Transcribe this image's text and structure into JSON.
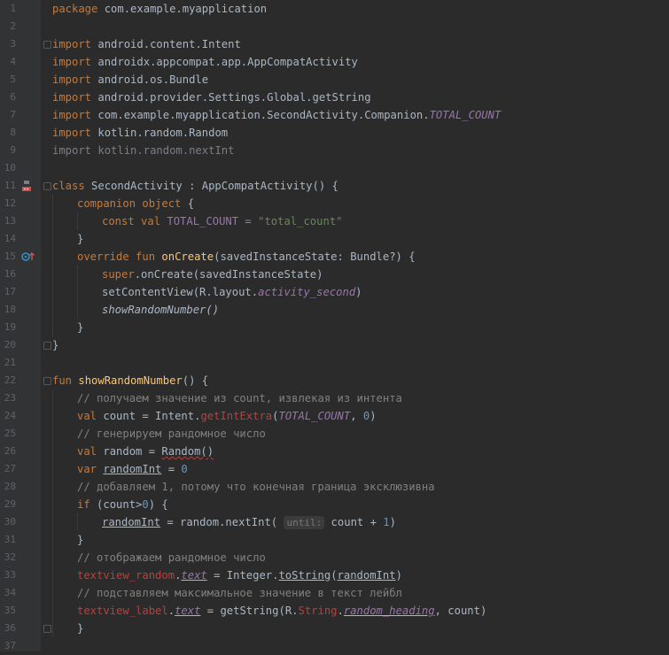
{
  "editor": {
    "line_numbers": [
      "1",
      "2",
      "3",
      "4",
      "5",
      "6",
      "7",
      "8",
      "9",
      "10",
      "11",
      "12",
      "13",
      "14",
      "15",
      "16",
      "17",
      "18",
      "19",
      "20",
      "21",
      "22",
      "23",
      "24",
      "25",
      "26",
      "27",
      "28",
      "29",
      "30",
      "31",
      "32",
      "33",
      "34",
      "35",
      "36",
      "37"
    ],
    "gutter_icons": {
      "line11": "class-hierarchy-icon",
      "line15": "override-method-icon"
    },
    "code": {
      "l1_kw": "package",
      "l1_rest": " com.example.myapplication",
      "l3_kw": "import",
      "l3_rest": " android.content.Intent",
      "l4_kw": "import",
      "l4_rest": " androidx.appcompat.app.AppCompatActivity",
      "l5_kw": "import",
      "l5_rest": " android.os.Bundle",
      "l6_kw": "import",
      "l6_rest": " android.provider.Settings.Global.getString",
      "l7_kw": "import",
      "l7_rest": " com.example.myapplication.SecondActivity.Companion.",
      "l7_prop": "TOTAL_COUNT",
      "l8_kw": "import",
      "l8_rest": " kotlin.random.Random",
      "l9_kw": "import",
      "l9_rest": " kotlin.random.nextInt",
      "l11_kw": "class",
      "l11_rest": " SecondActivity : AppCompatActivity() {",
      "l12_kw": "companion object",
      "l12_rest": " {",
      "l13_kw": "const val",
      "l13_mid": " TOTAL_COUNT = ",
      "l13_str": "\"total_count\"",
      "l14": "}",
      "l15_kw": "override fun",
      "l15_fn": "onCreate",
      "l15_rest": "(savedInstanceState: Bundle?) {",
      "l16_kw": "super",
      "l16_rest": ".onCreate(savedInstanceState)",
      "l17_a": "setContentView(R.layout.",
      "l17_prop": "activity_second",
      "l17_b": ")",
      "l18": "showRandomNumber()",
      "l19": "}",
      "l20": "}",
      "l22_kw": "fun",
      "l22_fn": "showRandomNumber",
      "l22_rest": "() {",
      "l23": "// получаем значение из count, извлекая из интента",
      "l24_kw": "val",
      "l24_a": " count = Intent.",
      "l24_err": "getIntExtra",
      "l24_b": "(",
      "l24_prop": "TOTAL_COUNT",
      "l24_c": ", ",
      "l24_num": "0",
      "l24_d": ")",
      "l25": "// генерируем рандомное число",
      "l26_kw": "val",
      "l26_a": " random = ",
      "l26_err": "Random()",
      "l27_kw": "var",
      "l27_var": "randomInt",
      "l27_a": " = ",
      "l27_num": "0",
      "l28": "// добавляем 1, потому что конечная граница эксклюзивна",
      "l29_kw": "if",
      "l29_a": " (count>",
      "l29_num": "0",
      "l29_b": ") {",
      "l30_var": "randomInt",
      "l30_a": " = random.nextInt( ",
      "l30_hint": "until:",
      "l30_b": " count + ",
      "l30_num": "1",
      "l30_c": ")",
      "l31": "}",
      "l32": "// отображаем рандомное число",
      "l33_err": "textview_random",
      "l33_a": ".",
      "l33_prop": "text",
      "l33_b": " = Integer.",
      "l33_fn": "toString",
      "l33_c": "(",
      "l33_var": "randomInt",
      "l33_d": ")",
      "l34": "// подставляем максимальное значение в текст лейбл",
      "l35_err": "textview_label",
      "l35_a": ".",
      "l35_prop": "text",
      "l35_b": " = getString(R.",
      "l35_err2": "String",
      "l35_c": ".",
      "l35_prop2": "random_heading",
      "l35_d": ", count)",
      "l36": "}"
    }
  },
  "colors": {
    "background": "#2b2b2b",
    "gutter": "#313335",
    "keyword": "#cc7832",
    "string": "#6a8759",
    "number": "#6897bb",
    "comment": "#808080",
    "function": "#ffc66d",
    "property": "#9876aa",
    "error": "#bc3f3c",
    "text": "#a9b7c6"
  }
}
